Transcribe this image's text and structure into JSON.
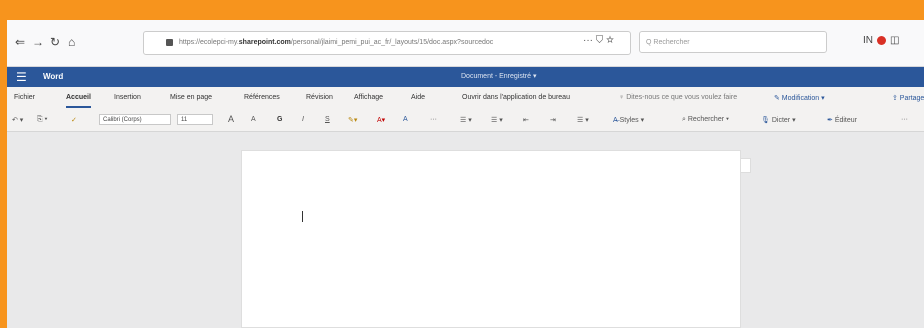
{
  "browser": {
    "nav": {
      "back": "⇐",
      "forward": "→",
      "reload": "↻",
      "home": "⌂"
    },
    "url_prefix": "https://ecolepci-my.",
    "url_domain": "sharepoint.com",
    "url_rest": "/personal/jlaimi_pemi_pui_ac_fr/_layouts/15/doc.aspx?sourcedoc",
    "url_actions": "··· ⛉ ☆",
    "search_placeholder": "Q  Rechercher",
    "toolbar_icons": "IN"
  },
  "word": {
    "waffle": "☰",
    "app_name": "Word",
    "doc_title": "Document - Enregistré ▾"
  },
  "tabs": [
    {
      "label": "Fichier"
    },
    {
      "label": "Accueil"
    },
    {
      "label": "Insertion"
    },
    {
      "label": "Mise en page"
    },
    {
      "label": "Références"
    },
    {
      "label": "Révision"
    },
    {
      "label": "Affichage"
    },
    {
      "label": "Aide"
    },
    {
      "label": "Ouvrir dans l'application de bureau"
    },
    {
      "label": "♀  Dites-nous ce que vous voulez faire"
    }
  ],
  "ribbon_right": {
    "modification": "✎ Modification ▾",
    "partager": "⇪ Partager"
  },
  "toolbar": {
    "undo": "↶ ▾",
    "paste": "⎘ ▾",
    "format_painter": "✓",
    "font_name": "Calibri (Corps)",
    "font_size": "11",
    "grow": "A",
    "shrink": "A",
    "bold": "G",
    "italic": "I",
    "underline": "S",
    "highlight": "✎▾",
    "font_color": "A▾",
    "clear": "A",
    "more": "···",
    "bullets": "☰ ▾",
    "numbering": "☰ ▾",
    "indent_dec": "⇤",
    "indent_inc": "⇥",
    "align": "☰ ▾",
    "styles": "Styles ▾",
    "find": "⌕ Rechercher ▾",
    "dictate": "Dicter ▾",
    "editor": "Éditeur",
    "overflow": "···"
  }
}
